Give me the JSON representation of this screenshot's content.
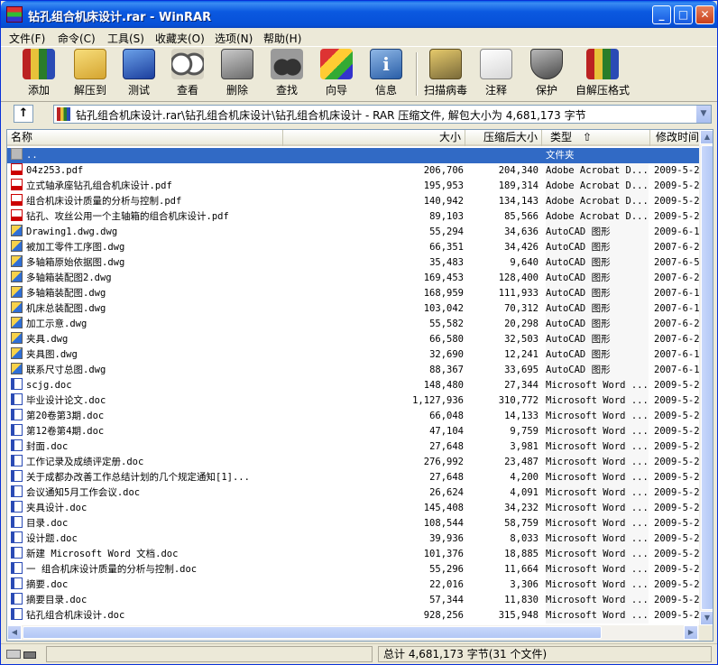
{
  "window": {
    "title": "钻孔组合机床设计.rar - WinRAR",
    "minimize": "_",
    "maximize": "□",
    "close": "✕"
  },
  "menu": [
    "文件(F)",
    "命令(C)",
    "工具(S)",
    "收藏夹(O)",
    "选项(N)",
    "帮助(H)"
  ],
  "toolbar": [
    {
      "label": "添加",
      "icon": "add-books-icon"
    },
    {
      "label": "解压到",
      "icon": "extract-folder-icon"
    },
    {
      "label": "测试",
      "icon": "test-icon"
    },
    {
      "label": "查看",
      "icon": "view-glasses-icon"
    },
    {
      "label": "删除",
      "icon": "delete-trash-icon"
    },
    {
      "label": "查找",
      "icon": "find-binoculars-icon"
    },
    {
      "label": "向导",
      "icon": "wizard-icon"
    },
    {
      "label": "信息",
      "icon": "info-icon"
    },
    {
      "label": "扫描病毒",
      "icon": "virus-scan-icon"
    },
    {
      "label": "注释",
      "icon": "comment-icon"
    },
    {
      "label": "保护",
      "icon": "protect-shield-icon"
    },
    {
      "label": "自解压格式",
      "icon": "sfx-icon"
    }
  ],
  "address": {
    "up_label": "↑",
    "path": "钻孔组合机床设计.rar\\钻孔组合机床设计\\钻孔组合机床设计 - RAR 压缩文件, 解包大小为 4,681,173 字节"
  },
  "columns": {
    "name": "名称",
    "size": "大小",
    "packed": "压缩后大小",
    "type": "类型",
    "modified": "修改时间",
    "sort_indicator": "⇧"
  },
  "files": [
    {
      "icon": "folder",
      "name": "..",
      "size": "",
      "packed": "",
      "type": "文件夹",
      "modified": "",
      "selected": true
    },
    {
      "icon": "pdf",
      "name": "04z253.pdf",
      "size": "206,706",
      "packed": "204,340",
      "type": "Adobe Acrobat D...",
      "modified": "2009-5-2"
    },
    {
      "icon": "pdf",
      "name": "立式轴承座钻孔组合机床设计.pdf",
      "size": "195,953",
      "packed": "189,314",
      "type": "Adobe Acrobat D...",
      "modified": "2009-5-2"
    },
    {
      "icon": "pdf",
      "name": "组合机床设计质量的分析与控制.pdf",
      "size": "140,942",
      "packed": "134,143",
      "type": "Adobe Acrobat D...",
      "modified": "2009-5-2"
    },
    {
      "icon": "pdf",
      "name": "钻孔、攻丝公用一个主轴箱的组合机床设计.pdf",
      "size": "89,103",
      "packed": "85,566",
      "type": "Adobe Acrobat D...",
      "modified": "2009-5-2"
    },
    {
      "icon": "dwg",
      "name": "Drawing1.dwg.dwg",
      "size": "55,294",
      "packed": "34,636",
      "type": "AutoCAD 图形",
      "modified": "2009-6-1"
    },
    {
      "icon": "dwg",
      "name": "被加工零件工序图.dwg",
      "size": "66,351",
      "packed": "34,426",
      "type": "AutoCAD 图形",
      "modified": "2007-6-2"
    },
    {
      "icon": "dwg",
      "name": "多轴箱原始依据图.dwg",
      "size": "35,483",
      "packed": "9,640",
      "type": "AutoCAD 图形",
      "modified": "2007-6-5"
    },
    {
      "icon": "dwg",
      "name": "多轴箱装配图2.dwg",
      "size": "169,453",
      "packed": "128,400",
      "type": "AutoCAD 图形",
      "modified": "2007-6-2"
    },
    {
      "icon": "dwg",
      "name": "多轴箱装配图.dwg",
      "size": "168,959",
      "packed": "111,933",
      "type": "AutoCAD 图形",
      "modified": "2007-6-1"
    },
    {
      "icon": "dwg",
      "name": "机床总装配图.dwg",
      "size": "103,042",
      "packed": "70,312",
      "type": "AutoCAD 图形",
      "modified": "2007-6-1"
    },
    {
      "icon": "dwg",
      "name": "加工示意.dwg",
      "size": "55,582",
      "packed": "20,298",
      "type": "AutoCAD 图形",
      "modified": "2007-6-2"
    },
    {
      "icon": "dwg",
      "name": "夹具.dwg",
      "size": "66,580",
      "packed": "32,503",
      "type": "AutoCAD 图形",
      "modified": "2007-6-2"
    },
    {
      "icon": "dwg",
      "name": "夹具图.dwg",
      "size": "32,690",
      "packed": "12,241",
      "type": "AutoCAD 图形",
      "modified": "2007-6-1"
    },
    {
      "icon": "dwg",
      "name": "联系尺寸总图.dwg",
      "size": "88,367",
      "packed": "33,695",
      "type": "AutoCAD 图形",
      "modified": "2007-6-1"
    },
    {
      "icon": "doc",
      "name": "scjg.doc",
      "size": "148,480",
      "packed": "27,344",
      "type": "Microsoft Word ...",
      "modified": "2009-5-2"
    },
    {
      "icon": "doc",
      "name": "毕业设计论文.doc",
      "size": "1,127,936",
      "packed": "310,772",
      "type": "Microsoft Word ...",
      "modified": "2009-5-2"
    },
    {
      "icon": "doc",
      "name": "第20卷第3期.doc",
      "size": "66,048",
      "packed": "14,133",
      "type": "Microsoft Word ...",
      "modified": "2009-5-2"
    },
    {
      "icon": "doc",
      "name": "第12卷第4期.doc",
      "size": "47,104",
      "packed": "9,759",
      "type": "Microsoft Word ...",
      "modified": "2009-5-2"
    },
    {
      "icon": "doc",
      "name": "封面.doc",
      "size": "27,648",
      "packed": "3,981",
      "type": "Microsoft Word ...",
      "modified": "2009-5-2"
    },
    {
      "icon": "doc",
      "name": "工作记录及成绩评定册.doc",
      "size": "276,992",
      "packed": "23,487",
      "type": "Microsoft Word ...",
      "modified": "2009-5-2"
    },
    {
      "icon": "doc",
      "name": "关于成都办改善工作总结计划的几个规定通知[1]...",
      "size": "27,648",
      "packed": "4,200",
      "type": "Microsoft Word ...",
      "modified": "2009-5-2"
    },
    {
      "icon": "doc",
      "name": "会议通知5月工作会议.doc",
      "size": "26,624",
      "packed": "4,091",
      "type": "Microsoft Word ...",
      "modified": "2009-5-2"
    },
    {
      "icon": "doc",
      "name": "夹具设计.doc",
      "size": "145,408",
      "packed": "34,232",
      "type": "Microsoft Word ...",
      "modified": "2009-5-2"
    },
    {
      "icon": "doc",
      "name": "目录.doc",
      "size": "108,544",
      "packed": "58,759",
      "type": "Microsoft Word ...",
      "modified": "2009-5-2"
    },
    {
      "icon": "doc",
      "name": "设计题.doc",
      "size": "39,936",
      "packed": "8,033",
      "type": "Microsoft Word ...",
      "modified": "2009-5-2"
    },
    {
      "icon": "doc",
      "name": "新建 Microsoft Word 文档.doc",
      "size": "101,376",
      "packed": "18,885",
      "type": "Microsoft Word ...",
      "modified": "2009-5-2"
    },
    {
      "icon": "doc",
      "name": "一 组合机床设计质量的分析与控制.doc",
      "size": "55,296",
      "packed": "11,664",
      "type": "Microsoft Word ...",
      "modified": "2009-5-2"
    },
    {
      "icon": "doc",
      "name": "摘要.doc",
      "size": "22,016",
      "packed": "3,306",
      "type": "Microsoft Word ...",
      "modified": "2009-5-2"
    },
    {
      "icon": "doc",
      "name": "摘要目录.doc",
      "size": "57,344",
      "packed": "11,830",
      "type": "Microsoft Word ...",
      "modified": "2009-5-2"
    },
    {
      "icon": "doc",
      "name": "钻孔组合机床设计.doc",
      "size": "928,256",
      "packed": "315,948",
      "type": "Microsoft Word ...",
      "modified": "2009-5-2"
    }
  ],
  "scroll": {
    "up": "▲",
    "down": "▼",
    "left": "◀",
    "right": "▶"
  },
  "status": {
    "left": "",
    "total": "总计 4,681,173 字节(31 个文件)"
  },
  "colors": {
    "titlebar": "#0b59e0",
    "selection": "#316ac5",
    "window_bg": "#ece9d8"
  }
}
